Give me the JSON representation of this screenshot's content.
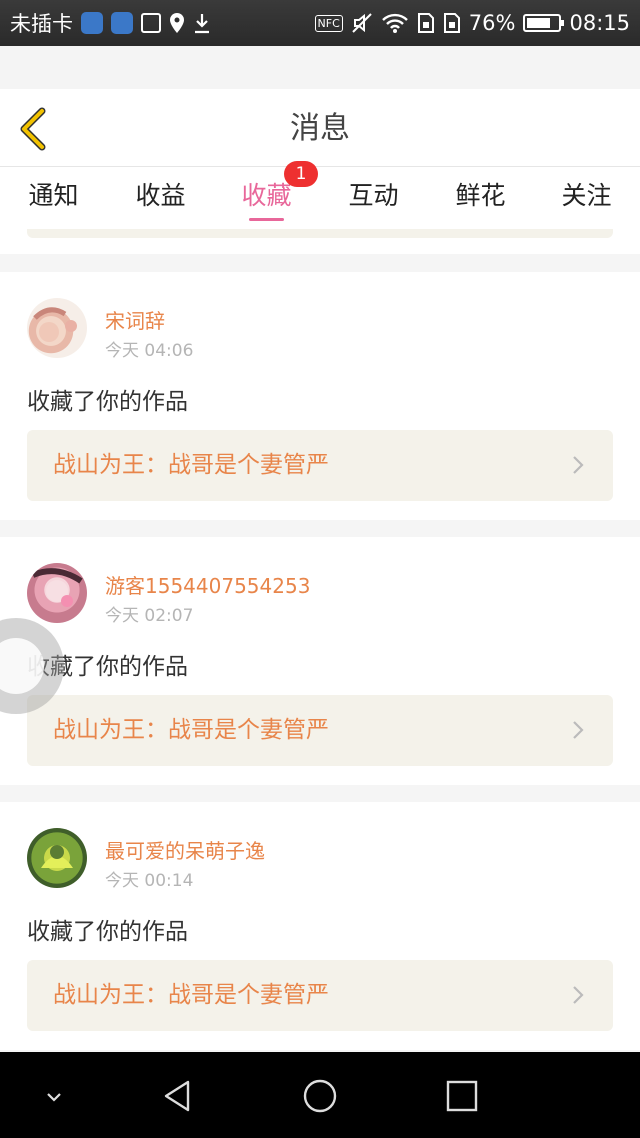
{
  "status_bar": {
    "carrier": "未插卡",
    "battery": "76%",
    "battery_level": 0.76,
    "time": "08:15",
    "nfc": "NFC",
    "icons": [
      "baidu-icon",
      "baidu-icon",
      "image-icon",
      "location-icon",
      "download-icon",
      "nfc-icon",
      "mute-icon",
      "wifi-icon",
      "sim-icon",
      "sim-icon",
      "battery-icon"
    ]
  },
  "header": {
    "title": "消息",
    "back_icon": "chevron-left-icon"
  },
  "tabs": [
    {
      "label": "通知"
    },
    {
      "label": "收益"
    },
    {
      "label": "收藏",
      "badge": "1",
      "active": true
    },
    {
      "label": "互动"
    },
    {
      "label": "鲜花"
    },
    {
      "label": "关注"
    }
  ],
  "messages": [
    {
      "user": "宋词辞",
      "time": "今天 04:06",
      "action": "收藏了你的作品",
      "work": "战山为王：战哥是个妻管严"
    },
    {
      "user": "游客1554407554253",
      "time": "今天 02:07",
      "action": "收藏了你的作品",
      "work": "战山为王：战哥是个妻管严"
    },
    {
      "user": "最可爱的呆萌子逸",
      "time": "今天 00:14",
      "action": "收藏了你的作品",
      "work": "战山为王：战哥是个妻管严"
    }
  ],
  "colors": {
    "accent": "#e8679a",
    "name": "#e8854a",
    "badge": "#ee3030",
    "header_back": "#f2c200"
  }
}
